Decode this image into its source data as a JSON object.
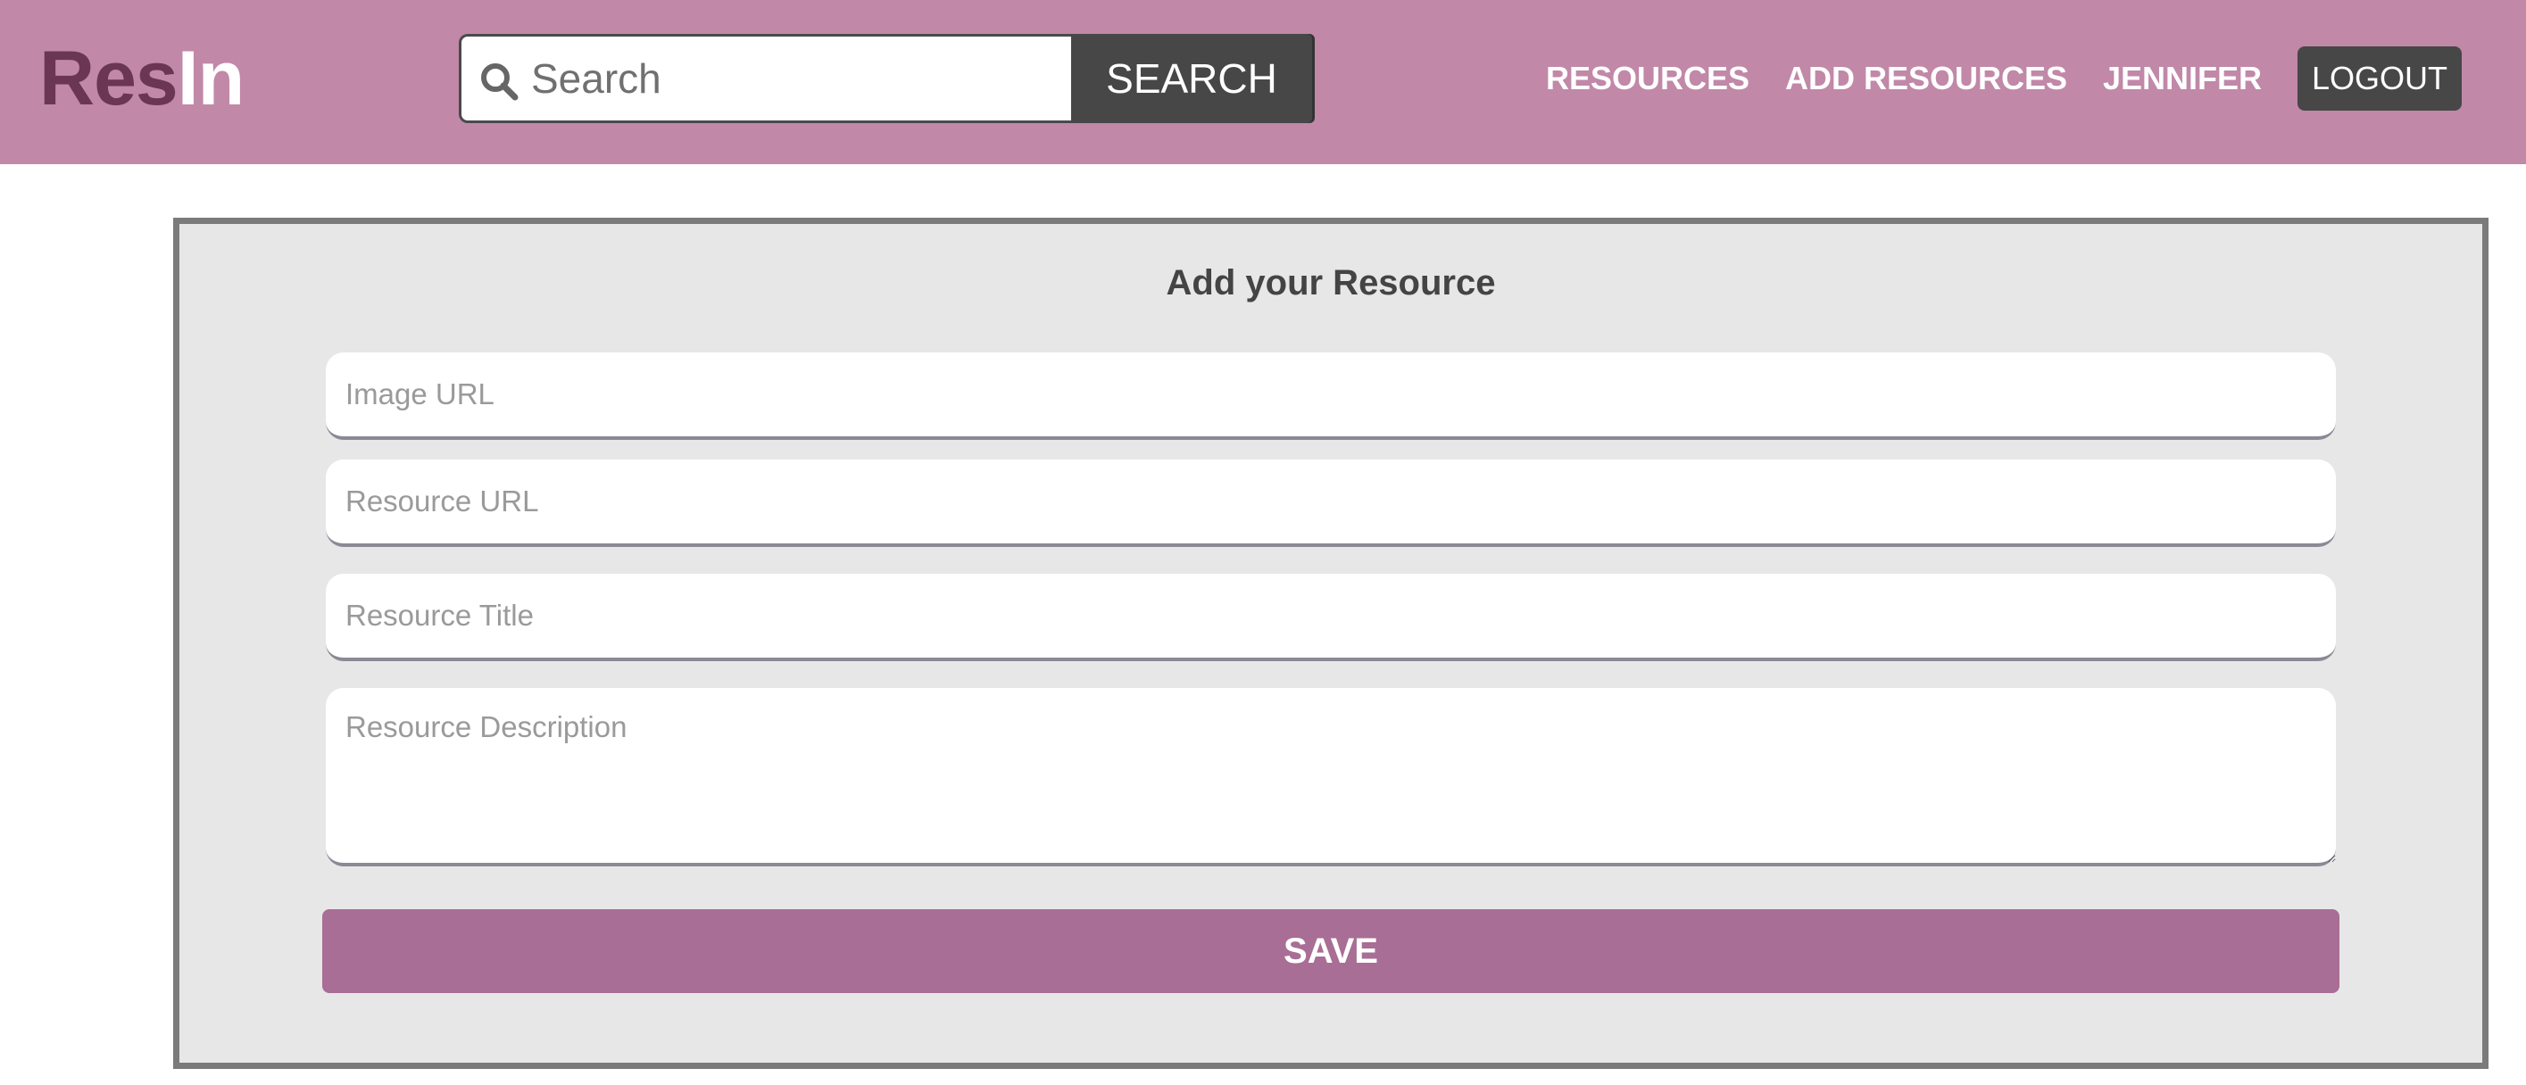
{
  "app": {
    "logo_part1": "Res",
    "logo_part2": "In"
  },
  "colors": {
    "header_bg": "#c188a8",
    "logo_dark": "#6a3654",
    "dark_button": "#474747",
    "card_bg": "#e7e7e7",
    "card_border": "#7b7b7b",
    "save_button": "#a86e95"
  },
  "search": {
    "placeholder": "Search",
    "value": "",
    "button_label": "SEARCH",
    "icon": "search-icon"
  },
  "nav": {
    "resources": "RESOURCES",
    "add_resources": "ADD RESOURCES",
    "user": "JENNIFER",
    "logout": "LOGOUT"
  },
  "form": {
    "title": "Add your Resource",
    "image_url": {
      "placeholder": "Image URL",
      "value": ""
    },
    "resource_url": {
      "placeholder": "Resource URL",
      "value": ""
    },
    "resource_title": {
      "placeholder": "Resource Title",
      "value": ""
    },
    "resource_description": {
      "placeholder": "Resource Description",
      "value": ""
    },
    "save_label": "SAVE"
  }
}
